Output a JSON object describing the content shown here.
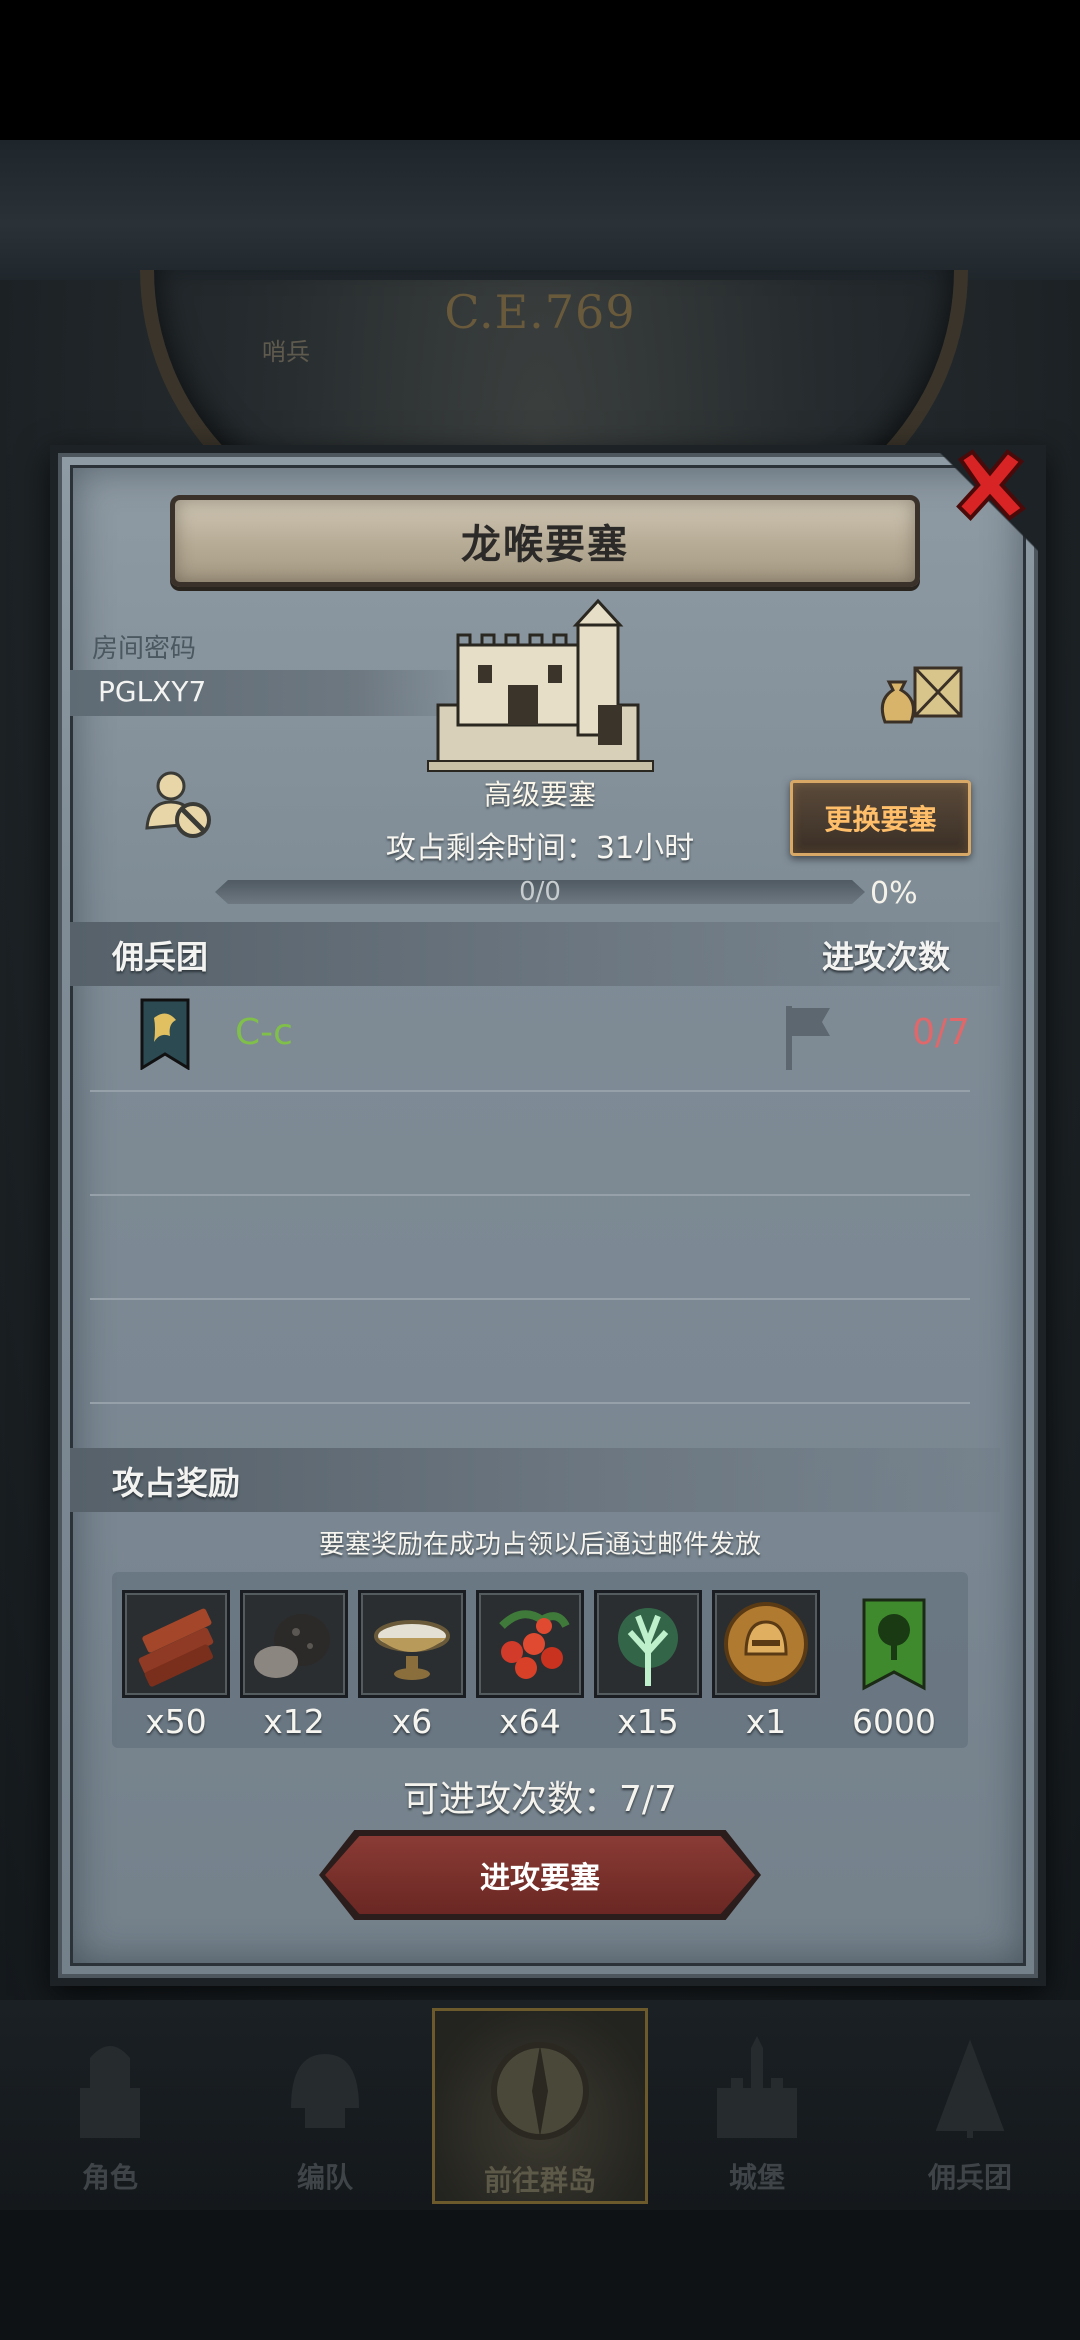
{
  "header": {
    "era": "C.E.769",
    "scene_label": "哨兵"
  },
  "dialog": {
    "title": "龙喉要塞",
    "room_code_label": "房间密码",
    "room_code": "PGLXY7",
    "fortress_type": "高级要塞",
    "change_button": "更换要塞",
    "time_left": "攻占剩余时间：31小时",
    "progress": {
      "value_text": "0/0",
      "percent_text": "0%",
      "fraction": 0
    },
    "mercenary": {
      "title": "佣兵团",
      "attempts_title": "进攻次数",
      "rows": [
        {
          "name": "C-c",
          "attempts": "0/7"
        }
      ]
    },
    "rewards": {
      "title": "攻占奖励",
      "note": "要塞奖励在成功占领以后通过邮件发放",
      "items": [
        {
          "icon": "wood-icon",
          "qty": "x50"
        },
        {
          "icon": "ore-icon",
          "qty": "x12"
        },
        {
          "icon": "bowl-icon",
          "qty": "x6"
        },
        {
          "icon": "berries-icon",
          "qty": "x64"
        },
        {
          "icon": "spirit-tree-icon",
          "qty": "x15"
        },
        {
          "icon": "helmet-medal-icon",
          "qty": "x1"
        },
        {
          "icon": "tree-banner-icon",
          "qty": "6000"
        }
      ]
    },
    "attack_count": "可进攻次数：7/7",
    "attack_button": "进攻要塞"
  },
  "bottom_nav": {
    "items": [
      {
        "label": "角色"
      },
      {
        "label": "编队"
      },
      {
        "label": "前往群岛"
      },
      {
        "label": "城堡"
      },
      {
        "label": "佣兵团"
      }
    ]
  }
}
